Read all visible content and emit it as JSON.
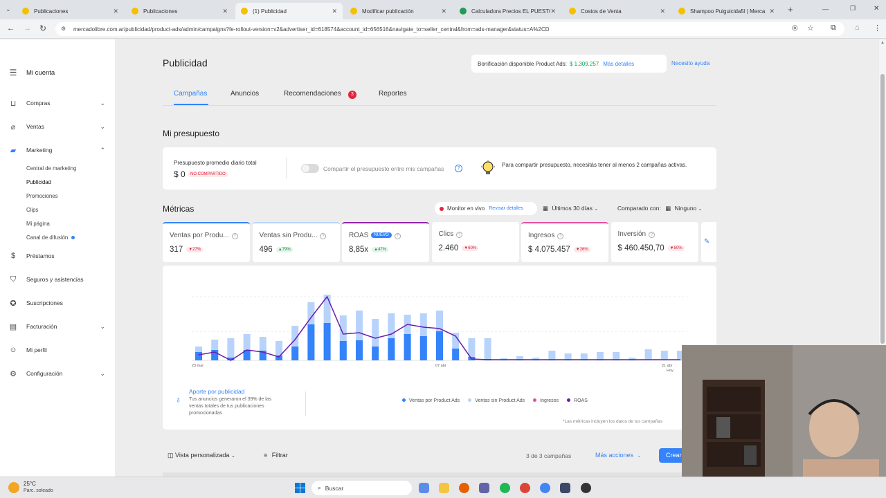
{
  "browser": {
    "tabs": [
      {
        "title": "Publicaciones",
        "color": "#f5c000"
      },
      {
        "title": "Publicaciones",
        "color": "#f5c000"
      },
      {
        "title": "(1) Publicidad",
        "color": "#f5c000"
      },
      {
        "title": "Modificar publicación",
        "color": "#f5c000"
      },
      {
        "title": "Calculadora Precios EL PUESTO",
        "color": "#1f9d55"
      },
      {
        "title": "Costos de Venta",
        "color": "#f5c000"
      },
      {
        "title": "Shampoo Pulguicida5l | Merca",
        "color": "#f5c000"
      }
    ],
    "new_tab": "+",
    "url": "mercadolibre.com.ar/publicidad/product-ads/admin/campaigns?fe-rollout-version=v2&advertiser_id=618574&account_id=656516&navigate_to=seller_central&from=ads-manager&status=A%2CD"
  },
  "sidebar": {
    "account": "Mi cuenta",
    "items": [
      {
        "label": "Compras",
        "icon": "bag-icon",
        "chevron": "⌄"
      },
      {
        "label": "Ventas",
        "icon": "tag-icon",
        "chevron": "⌄"
      },
      {
        "label": "Marketing",
        "icon": "megaphone-icon",
        "chevron": "⌃"
      }
    ],
    "marketing_sub": [
      "Central de marketing",
      "Publicidad",
      "Promociones",
      "Clips",
      "Mi página",
      "Canal de difusión"
    ],
    "items2": [
      {
        "label": "Préstamos",
        "icon": "money-icon",
        "chevron": ""
      },
      {
        "label": "Seguros y asistencias",
        "icon": "shield-icon",
        "chevron": ""
      },
      {
        "label": "Suscripciones",
        "icon": "subscription-icon",
        "chevron": ""
      },
      {
        "label": "Facturación",
        "icon": "invoice-icon",
        "chevron": "⌄"
      },
      {
        "label": "Mi perfil",
        "icon": "user-icon",
        "chevron": ""
      },
      {
        "label": "Configuración",
        "icon": "gear-icon",
        "chevron": "⌄"
      }
    ]
  },
  "header": {
    "title": "Publicidad",
    "bonus_label": "Bonificación disponible Product Ads:",
    "bonus_value": "$ 1.309.257",
    "bonus_link": "Más detalles",
    "help": "Necesito ayuda"
  },
  "tabs": {
    "items": [
      "Campañas",
      "Anuncios",
      "Recomendaciones",
      "Reportes"
    ],
    "badge": "3"
  },
  "budget": {
    "section_title": "Mi presupuesto",
    "label": "Presupuesto promedio diario total",
    "value": "$ 0",
    "tag": "NO COMPARTIDO",
    "toggle_label": "Compartir el presupuesto entre mis campañas",
    "info": "Para compartir presupuesto, necesitás tener al menos 2 campañas activas."
  },
  "metrics": {
    "section_title": "Métricas",
    "live_label": "Monitor en vivo",
    "live_link": "Revisar detalles",
    "period": "Últimos 30 días",
    "compare_label": "Comparado con:",
    "compare_value": "Ninguno",
    "cards": [
      {
        "label": "Ventas por Produ...",
        "value": "317",
        "delta": "27%",
        "dir": "down",
        "accent": "#3483fa"
      },
      {
        "label": "Ventas sin Produ...",
        "value": "496",
        "delta": "79%",
        "dir": "up",
        "accent": "#b8d3fb"
      },
      {
        "label": "ROAS",
        "value": "8,85x",
        "delta": "47%",
        "dir": "up",
        "accent": "#8e24aa",
        "badge": "NUEVO"
      },
      {
        "label": "Clics",
        "value": "2.460",
        "delta": "60%",
        "dir": "down",
        "accent": ""
      },
      {
        "label": "Ingresos",
        "value": "$ 4.075.457",
        "delta": "26%",
        "dir": "down",
        "accent": "#e64fa0"
      },
      {
        "label": "Inversión",
        "value": "$ 460.450,70",
        "delta": "50%",
        "dir": "down",
        "accent": ""
      }
    ]
  },
  "chart_data": {
    "type": "bar",
    "x_ticks": [
      "23 mar",
      "07 abr",
      "21 abr",
      "Hoy"
    ],
    "series": [
      {
        "name": "Ventas por Product Ads",
        "color": "#3483fa",
        "values": [
          12,
          15,
          4,
          15,
          14,
          7,
          20,
          52,
          54,
          28,
          29,
          20,
          32,
          38,
          35,
          42,
          17,
          5,
          2,
          1,
          1,
          1,
          1,
          1,
          1,
          1,
          1,
          1,
          0,
          0,
          0
        ]
      },
      {
        "name": "Ventas sin Product Ads",
        "color": "#b8d3fb",
        "values": [
          20,
          30,
          32,
          38,
          34,
          28,
          50,
          84,
          95,
          65,
          72,
          60,
          68,
          66,
          68,
          72,
          40,
          32,
          32,
          3,
          6,
          4,
          14,
          10,
          10,
          12,
          12,
          4,
          16,
          14,
          14
        ]
      },
      {
        "name": "Ingresos",
        "color": "#e64fa0",
        "values": []
      },
      {
        "name": "ROAS",
        "color": "#6a1bb0",
        "values": [
          8,
          12,
          0,
          15,
          12,
          5,
          30,
          62,
          92,
          38,
          40,
          32,
          38,
          52,
          48,
          46,
          35,
          2,
          1,
          1,
          1,
          1,
          1,
          1,
          1,
          1,
          1,
          1,
          1,
          1,
          1
        ]
      }
    ],
    "ylim": [
      0,
      100
    ]
  },
  "contribution": {
    "title": "Aporte por publicidad",
    "text": "Tus anuncios generaron el 39% de las ventas totales de tus publicaciones promocionadas",
    "footnote": "*Las métricas incluyen los datos de tus campañas"
  },
  "table_toolbar": {
    "view": "Vista personalizada",
    "filter": "Filtrar",
    "count": "3 de 3 campañas",
    "more": "Más acciones",
    "create": "Crear"
  },
  "taskbar": {
    "temp": "25°C",
    "weather": "Parc. soleado",
    "search": "Buscar"
  }
}
